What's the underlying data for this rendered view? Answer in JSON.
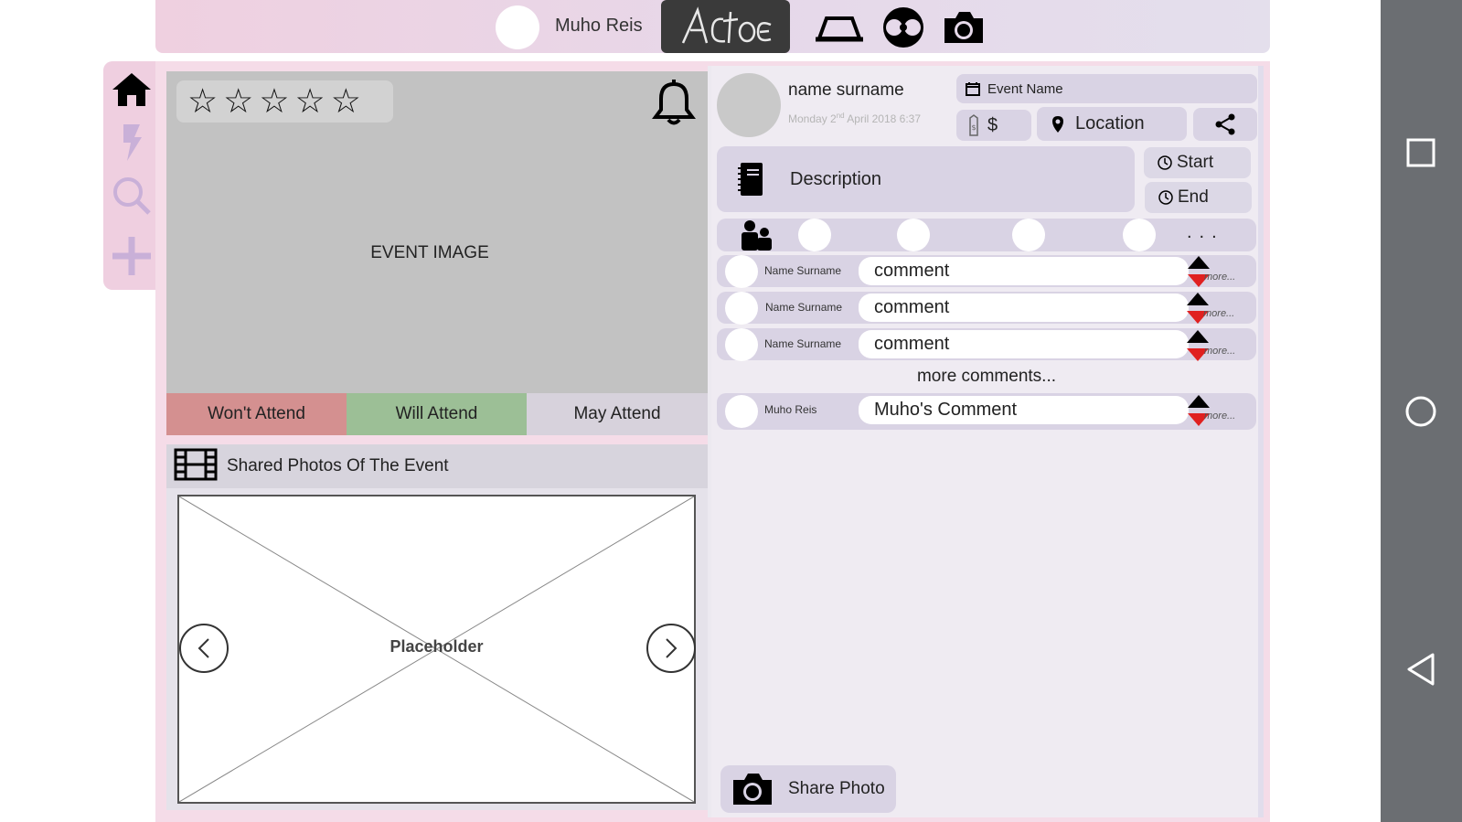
{
  "topbar": {
    "username": "Muho Reis",
    "logo_text": "Actoe",
    "icons": [
      "hat-icon",
      "film-reel-icon",
      "camera-icon"
    ]
  },
  "sidebar": {
    "items": [
      "home-icon",
      "lightning-icon",
      "search-icon",
      "plus-icon"
    ]
  },
  "event": {
    "image_label": "EVENT IMAGE",
    "rating_stars": 5,
    "rating_value": 0,
    "attend": {
      "wont": "Won't Attend",
      "will": "Will Attend",
      "may": "May Attend"
    },
    "photos_header": "Shared Photos Of The Event",
    "placeholder": "Placeholder"
  },
  "details": {
    "name": "name surname",
    "date_prefix": "Monday 2",
    "date_sup": "nd",
    "date_suffix": " April 2018 6:37",
    "event_name": "Event Name",
    "price": "$",
    "location": "Location",
    "description": "Description",
    "start": "Start",
    "end": "End",
    "attendees_more": "..."
  },
  "comments": [
    {
      "name": "Name Surname",
      "text": "comment",
      "more": "more..."
    },
    {
      "name": "Name Surname",
      "text": "comment",
      "more": "more..."
    },
    {
      "name": "Name Surname",
      "text": "comment",
      "more": "more..."
    }
  ],
  "more_comments": "more comments...",
  "own_comment": {
    "name": "Muho Reis",
    "text": "Muho's Comment",
    "more": "more..."
  },
  "share_photo": "Share Photo",
  "colors": {
    "wont": "#d49090",
    "will": "#9cbf96",
    "may": "#d7d2dc",
    "accent_pink": "#efcfe0",
    "panel_lavender": "#d9d3e4",
    "vote_down": "#e02020"
  }
}
